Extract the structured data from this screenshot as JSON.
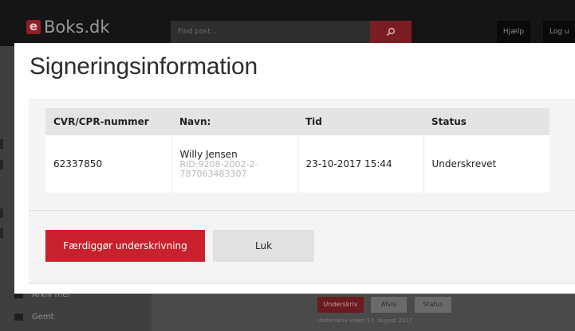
{
  "app": {
    "logo_letter": "e",
    "logo_name": "Boks.dk",
    "search_placeholder": "Find post...",
    "help_label": "Hjælp",
    "login_label": "Log u",
    "sidebar": {
      "item_partial": "Arkiv mer",
      "item_saved": "Gemt"
    },
    "actions": {
      "sign": "Underskriv",
      "reject": "Afvis",
      "status": "Status"
    },
    "deadline": "Underskriv inden 17. august 2017"
  },
  "modal": {
    "title": "Signeringsinformation",
    "table": {
      "headers": [
        "CVR/CPR-nummer",
        "Navn:",
        "Tid",
        "Status"
      ],
      "rows": [
        {
          "id": "62337850",
          "name": "Willy Jensen",
          "rid": "RID:9208-2002-2-787063483307",
          "time": "23-10-2017 15:44",
          "status": "Underskrevet"
        }
      ]
    },
    "finish_label": "Færdiggør underskrivning",
    "close_label": "Luk"
  },
  "colors": {
    "brand_red": "#c8202c",
    "overlay_dark": "#151515"
  }
}
